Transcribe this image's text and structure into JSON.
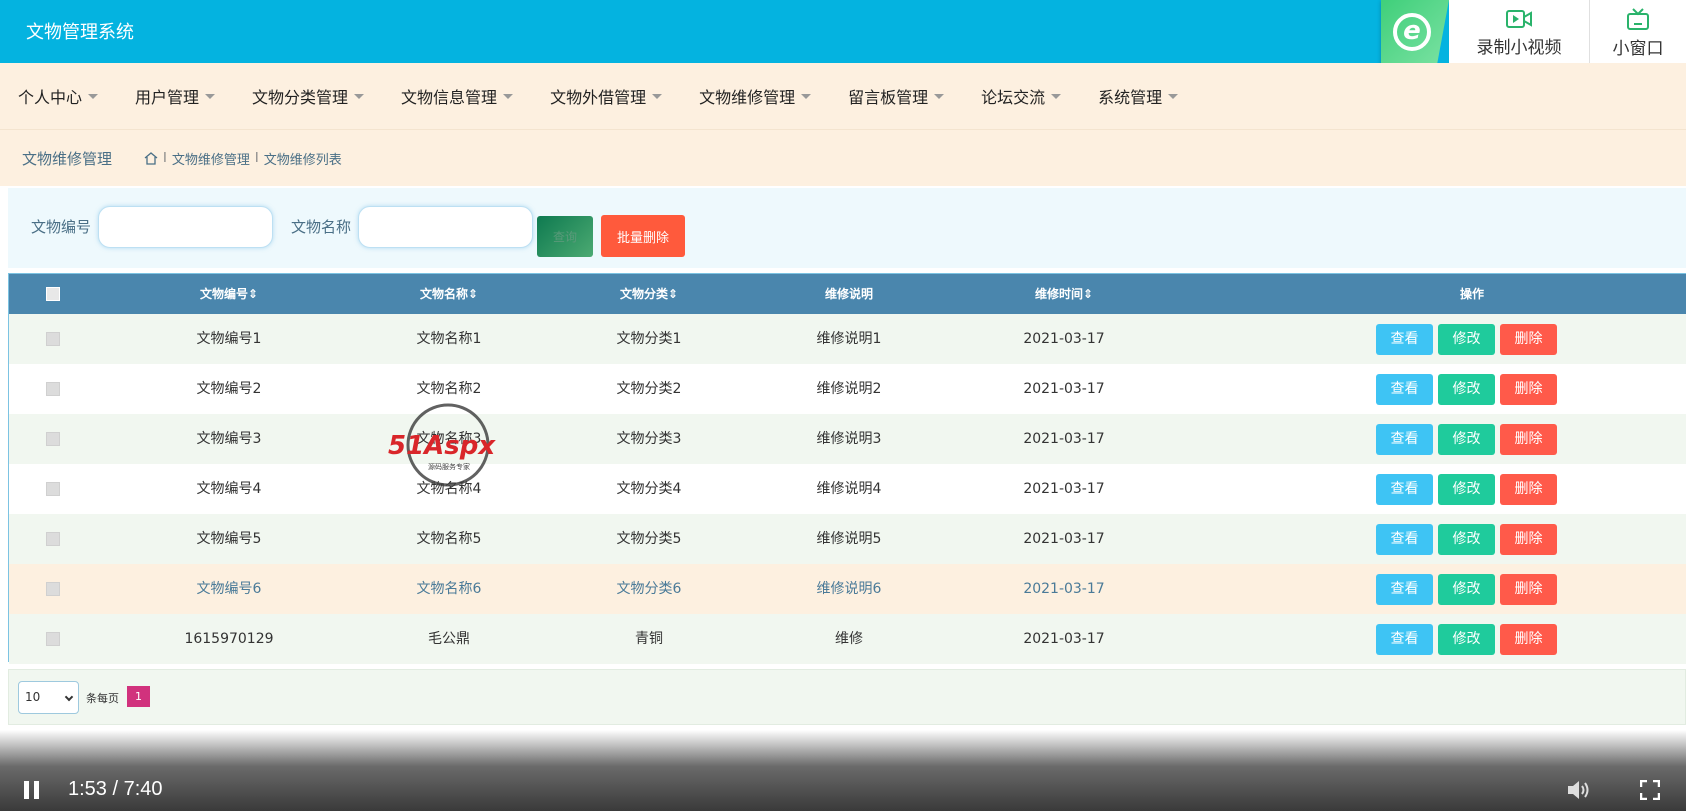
{
  "app": {
    "title": "文物管理系统"
  },
  "video_widget": {
    "record_label": "录制小视频",
    "mini_label": "小窗口"
  },
  "nav": {
    "items": [
      "个人中心",
      "用户管理",
      "文物分类管理",
      "文物信息管理",
      "文物外借管理",
      "文物维修管理",
      "留言板管理",
      "论坛交流",
      "系统管理"
    ]
  },
  "breadcrumb": {
    "title": "文物维修管理",
    "level1": "文物维修管理",
    "level2": "文物维修列表",
    "separator": "I"
  },
  "search": {
    "field1_label": "文物编号",
    "field2_label": "文物名称",
    "search_button": "查询",
    "batch_delete": "批量删除"
  },
  "table": {
    "headers": [
      "文物编号⇕",
      "文物名称⇕",
      "文物分类⇕",
      "维修说明",
      "维修时间⇕",
      "操作"
    ],
    "rows": [
      {
        "id": "文物编号1",
        "name": "文物名称1",
        "category": "文物分类1",
        "desc": "维修说明1",
        "time": "2021-03-17"
      },
      {
        "id": "文物编号2",
        "name": "文物名称2",
        "category": "文物分类2",
        "desc": "维修说明2",
        "time": "2021-03-17"
      },
      {
        "id": "文物编号3",
        "name": "文物名称3",
        "category": "文物分类3",
        "desc": "维修说明3",
        "time": "2021-03-17"
      },
      {
        "id": "文物编号4",
        "name": "文物名称4",
        "category": "文物分类4",
        "desc": "维修说明4",
        "time": "2021-03-17"
      },
      {
        "id": "文物编号5",
        "name": "文物名称5",
        "category": "文物分类5",
        "desc": "维修说明5",
        "time": "2021-03-17"
      },
      {
        "id": "文物编号6",
        "name": "文物名称6",
        "category": "文物分类6",
        "desc": "维修说明6",
        "time": "2021-03-17"
      },
      {
        "id": "1615970129",
        "name": "毛公鼎",
        "category": "青铜",
        "desc": "维修",
        "time": "2021-03-17"
      }
    ],
    "actions": {
      "view": "查看",
      "edit": "修改",
      "delete": "删除"
    }
  },
  "pagination": {
    "page_size": "10",
    "per_page_label": "条每页",
    "current_page": "1"
  },
  "video_player": {
    "time": "1:53 / 7:40"
  },
  "watermark": {
    "text": "51Aspx",
    "subtext": "源码服务专家"
  },
  "colors": {
    "header": "#04b3e0",
    "nav_bg": "#fdf0e0",
    "table_header": "#4a86ad",
    "view": "#3ec4f4",
    "edit": "#1fcb9c",
    "delete": "#ff5a4a",
    "page_active": "#d1327d"
  }
}
